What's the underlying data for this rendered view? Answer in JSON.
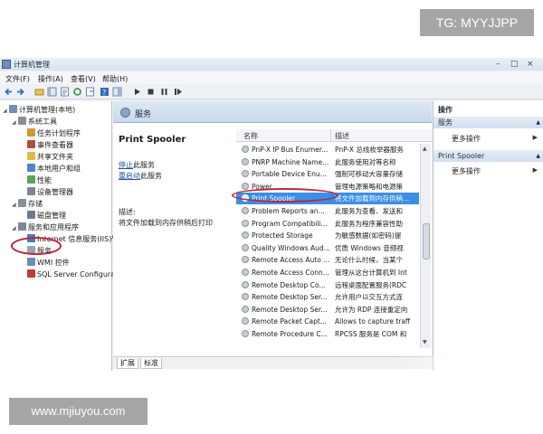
{
  "watermarks": {
    "tg": "TG: MYYJJPP",
    "site": "www.mjiuyou.com"
  },
  "window": {
    "title": "计算机管理",
    "controls": [
      "–",
      "□",
      "×"
    ],
    "menu": [
      "文件(F)",
      "操作(A)",
      "查看(V)",
      "帮助(H)"
    ]
  },
  "tree": [
    {
      "label": "计算机管理(本地)",
      "icon": "computer-icon",
      "indent": 0
    },
    {
      "label": "系统工具",
      "icon": "tools-icon",
      "indent": 1
    },
    {
      "label": "任务计划程序",
      "icon": "clock-icon",
      "indent": 2
    },
    {
      "label": "事件查看器",
      "icon": "event-viewer-icon",
      "indent": 2
    },
    {
      "label": "共享文件夹",
      "icon": "folder-icon",
      "indent": 2
    },
    {
      "label": "本地用户和组",
      "icon": "users-icon",
      "indent": 2
    },
    {
      "label": "性能",
      "icon": "performance-icon",
      "indent": 2
    },
    {
      "label": "设备管理器",
      "icon": "device-icon",
      "indent": 2
    },
    {
      "label": "存储",
      "icon": "storage-icon",
      "indent": 1
    },
    {
      "label": "磁盘管理",
      "icon": "disk-icon",
      "indent": 2
    },
    {
      "label": "服务和应用程序",
      "icon": "services-apps-icon",
      "indent": 1
    },
    {
      "label": "Internet 信息服务(IIS)管",
      "icon": "iis-icon",
      "indent": 2
    },
    {
      "label": "服务",
      "icon": "gear-icon",
      "indent": 2
    },
    {
      "label": "WMI 控件",
      "icon": "wmi-icon",
      "indent": 2
    },
    {
      "label": "SQL Server Configura",
      "icon": "sql-icon",
      "indent": 2
    }
  ],
  "center": {
    "header": "服务",
    "service_name": "Print Spooler",
    "stop_link": "停止",
    "stop_suffix": "此服务",
    "restart_link": "重启动",
    "restart_suffix": "此服务",
    "desc_label": "描述:",
    "desc_text": "将文件加载到内存供稍后打印",
    "columns": {
      "name": "名称",
      "desc": "描述"
    },
    "services": [
      {
        "name": "PnP-X IP Bus Enumer...",
        "desc": "PnP-X 总线枚举器服务"
      },
      {
        "name": "PNRP Machine Name...",
        "desc": "此服务使用对等名称"
      },
      {
        "name": "Portable Device Enu...",
        "desc": "强制可移动大容量存储"
      },
      {
        "name": "Power",
        "desc": "管理电源策略和电源策"
      },
      {
        "name": "Print Spooler",
        "desc": "将文件加载到内存供稍..."
      },
      {
        "name": "Problem Reports an...",
        "desc": "此服务为查看、发送和"
      },
      {
        "name": "Program Compatibili...",
        "desc": "此服务为程序兼容性助"
      },
      {
        "name": "Protected Storage",
        "desc": "为敏感数据(如密码)提"
      },
      {
        "name": "Quality Windows Aud...",
        "desc": "优质 Windows 音频视"
      },
      {
        "name": "Remote Access Auto ...",
        "desc": "无论什么时候，当某个"
      },
      {
        "name": "Remote Access Conn...",
        "desc": "管理从这台计算机到 Int"
      },
      {
        "name": "Remote Desktop Co...",
        "desc": "远程桌面配置服务(RDC"
      },
      {
        "name": "Remote Desktop Ser...",
        "desc": "允许用户以交互方式连"
      },
      {
        "name": "Remote Desktop Ser...",
        "desc": "允许为 RDP 连接重定向"
      },
      {
        "name": "Remote Packet Capt...",
        "desc": "Allows to capture traff"
      },
      {
        "name": "Remote Procedure C...",
        "desc": "RPCSS 服务是 COM 和"
      }
    ],
    "tabs": [
      "扩展",
      "标准"
    ]
  },
  "actions": {
    "title": "操作",
    "groups": [
      {
        "label": "服务",
        "item": "更多操作"
      },
      {
        "label": "Print Spooler",
        "item": "更多操作"
      }
    ]
  }
}
